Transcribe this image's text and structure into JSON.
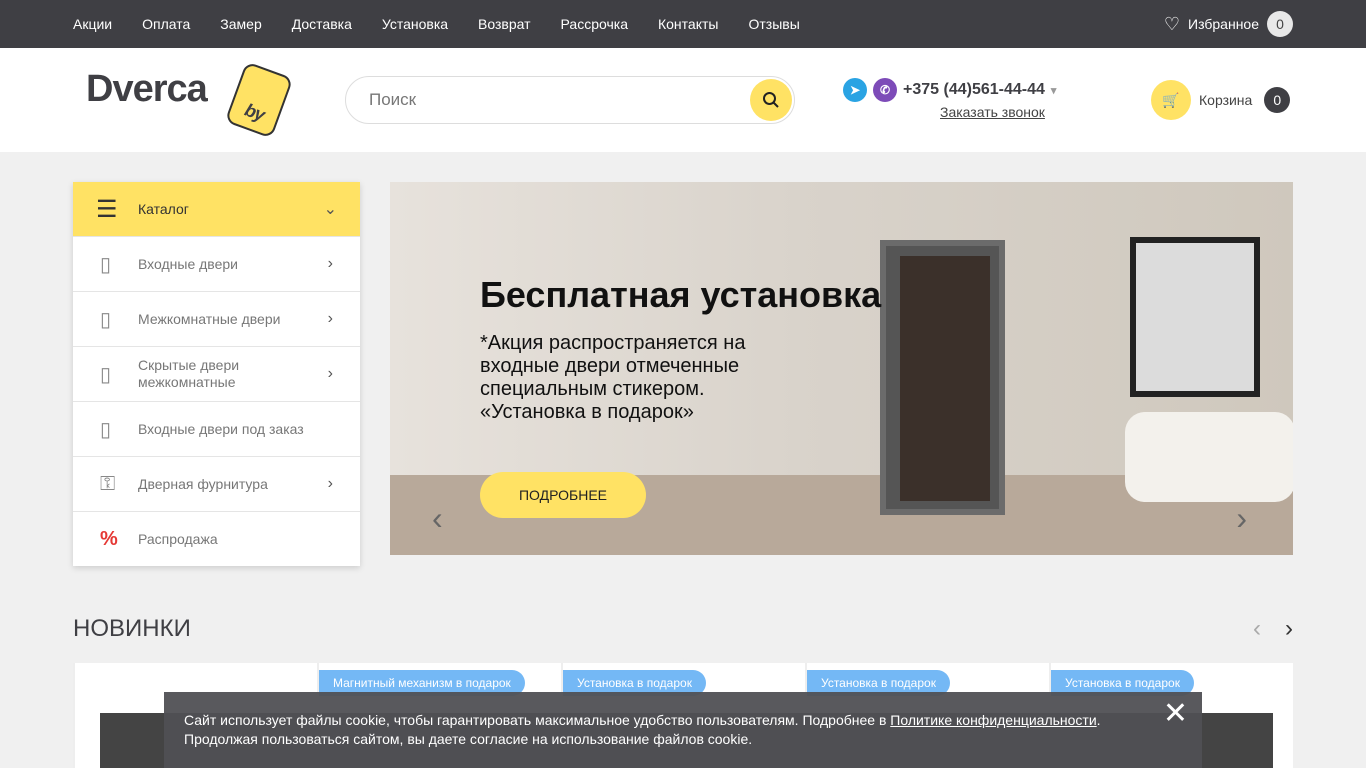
{
  "topnav": [
    "Акции",
    "Оплата",
    "Замер",
    "Доставка",
    "Установка",
    "Возврат",
    "Рассрочка",
    "Контакты",
    "Отзывы"
  ],
  "favorites": {
    "label": "Избранное",
    "count": "0"
  },
  "logo": {
    "text": "Dverca",
    "tag": "by"
  },
  "search": {
    "placeholder": "Поиск"
  },
  "phone": "+375 (44)561-44-44",
  "callback": "Заказать звонок",
  "cart": {
    "label": "Корзина",
    "count": "0"
  },
  "catalog": {
    "title": "Каталог",
    "items": [
      {
        "label": "Входные двери",
        "arrow": true
      },
      {
        "label": "Межкомнатные двери",
        "arrow": true
      },
      {
        "label": "Скрытые двери межкомнатные",
        "arrow": true
      },
      {
        "label": "Входные двери под заказ",
        "arrow": false
      },
      {
        "label": "Дверная фурнитура",
        "arrow": true
      },
      {
        "label": "Распродажа",
        "arrow": false
      }
    ]
  },
  "banner": {
    "title": "Бесплатная установка",
    "subtitle": "*Акция распространяется на входные двери отмеченные специальным стикером. «Установка в подарок»",
    "button": "ПОДРОБНЕЕ"
  },
  "news": {
    "title": "НОВИНКИ",
    "tags": [
      "",
      "Магнитный механизм в подарок",
      "Установка в подарок",
      "Установка в подарок",
      "Установка в подарок"
    ]
  },
  "cookie": {
    "text1": "Сайт использует файлы cookie, чтобы гарантировать максимальное удобство пользователям. Подробнее в ",
    "link": "Политике конфиденциальности",
    "text2": ".",
    "line2": "Продолжая пользоваться сайтом, вы даете согласие на использование файлов cookie."
  },
  "colors": {
    "accent": "#ffe264",
    "dark": "#3f3f44",
    "tag": "#74b8f5"
  }
}
